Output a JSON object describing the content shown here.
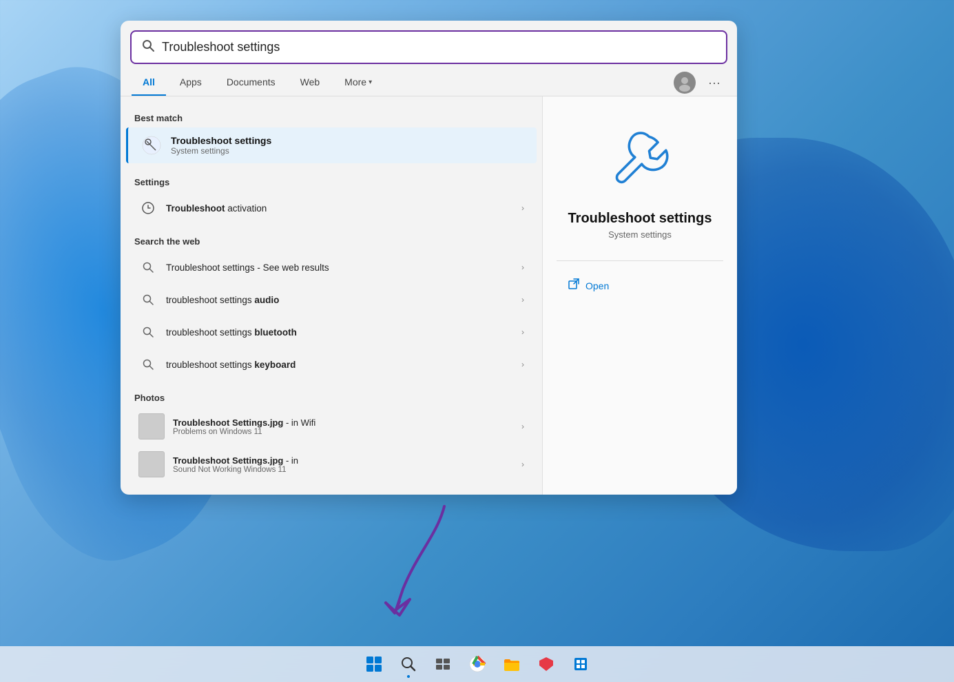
{
  "background": {
    "color_start": "#a8d4f5",
    "color_end": "#1a6aaf"
  },
  "search_panel": {
    "search_query": "Troubleshoot settings",
    "search_placeholder": "Troubleshoot settings"
  },
  "tabs": {
    "items": [
      {
        "label": "All",
        "active": true
      },
      {
        "label": "Apps",
        "active": false
      },
      {
        "label": "Documents",
        "active": false
      },
      {
        "label": "Web",
        "active": false
      },
      {
        "label": "More",
        "active": false,
        "has_chevron": true
      }
    ]
  },
  "best_match": {
    "section_label": "Best match",
    "title": "Troubleshoot settings",
    "subtitle": "System settings"
  },
  "settings_section": {
    "section_label": "Settings",
    "items": [
      {
        "text_before_bold": "Troubleshoot",
        "bold_text": "",
        "text_after": " activation"
      }
    ]
  },
  "web_section": {
    "section_label": "Search the web",
    "items": [
      {
        "text": "Troubleshoot settings",
        "suffix": " - See web results"
      },
      {
        "text": "troubleshoot settings ",
        "bold_text": "audio"
      },
      {
        "text": "troubleshoot settings ",
        "bold_text": "bluetooth"
      },
      {
        "text": "troubleshoot settings ",
        "bold_text": "keyboard"
      }
    ]
  },
  "photos_section": {
    "section_label": "Photos",
    "items": [
      {
        "title": "Troubleshoot Settings.jpg",
        "title_suffix": " - in Wifi",
        "subtitle": "Problems on Windows 11"
      },
      {
        "title": "Troubleshoot Settings.jpg",
        "title_suffix": " - in",
        "subtitle": "Sound Not Working Windows 11"
      }
    ]
  },
  "detail_panel": {
    "title": "Troubleshoot settings",
    "subtitle": "System settings",
    "open_label": "Open"
  },
  "taskbar": {
    "items": [
      {
        "name": "start",
        "icon": "⊞",
        "active": false
      },
      {
        "name": "search",
        "icon": "🔍",
        "active": true
      },
      {
        "name": "task-view",
        "icon": "▣",
        "active": false
      },
      {
        "name": "chrome",
        "icon": "◎",
        "active": false
      },
      {
        "name": "file-explorer",
        "icon": "📁",
        "active": false
      },
      {
        "name": "vpn",
        "icon": "⬡",
        "active": false
      },
      {
        "name": "settings-app",
        "icon": "⚙",
        "active": false
      }
    ]
  }
}
